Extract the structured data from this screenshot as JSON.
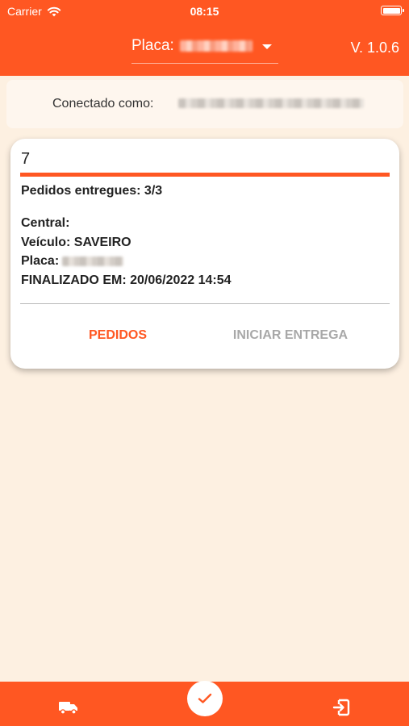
{
  "status_bar": {
    "carrier": "Carrier",
    "time": "08:15"
  },
  "header": {
    "plate_label": "Placa:",
    "version": "V. 1.0.6"
  },
  "connected": {
    "label": "Conectado como:"
  },
  "card": {
    "number": "7",
    "delivered": "Pedidos entregues: 3/3",
    "central": "Central:",
    "vehicle": "Veículo: SAVEIRO",
    "plate": "Placa:",
    "finished": "FINALIZADO EM: 20/06/2022 14:54",
    "actions": {
      "orders": "PEDIDOS",
      "start_delivery": "INICIAR ENTREGA"
    }
  },
  "bottom_nav": {
    "icons": [
      "truck-icon",
      "check-icon",
      "logout-icon"
    ]
  },
  "colors": {
    "primary": "#FF5722",
    "background": "#FDF0E1",
    "banner": "#FEF6EE",
    "disabled_text": "#A8A8A8"
  }
}
